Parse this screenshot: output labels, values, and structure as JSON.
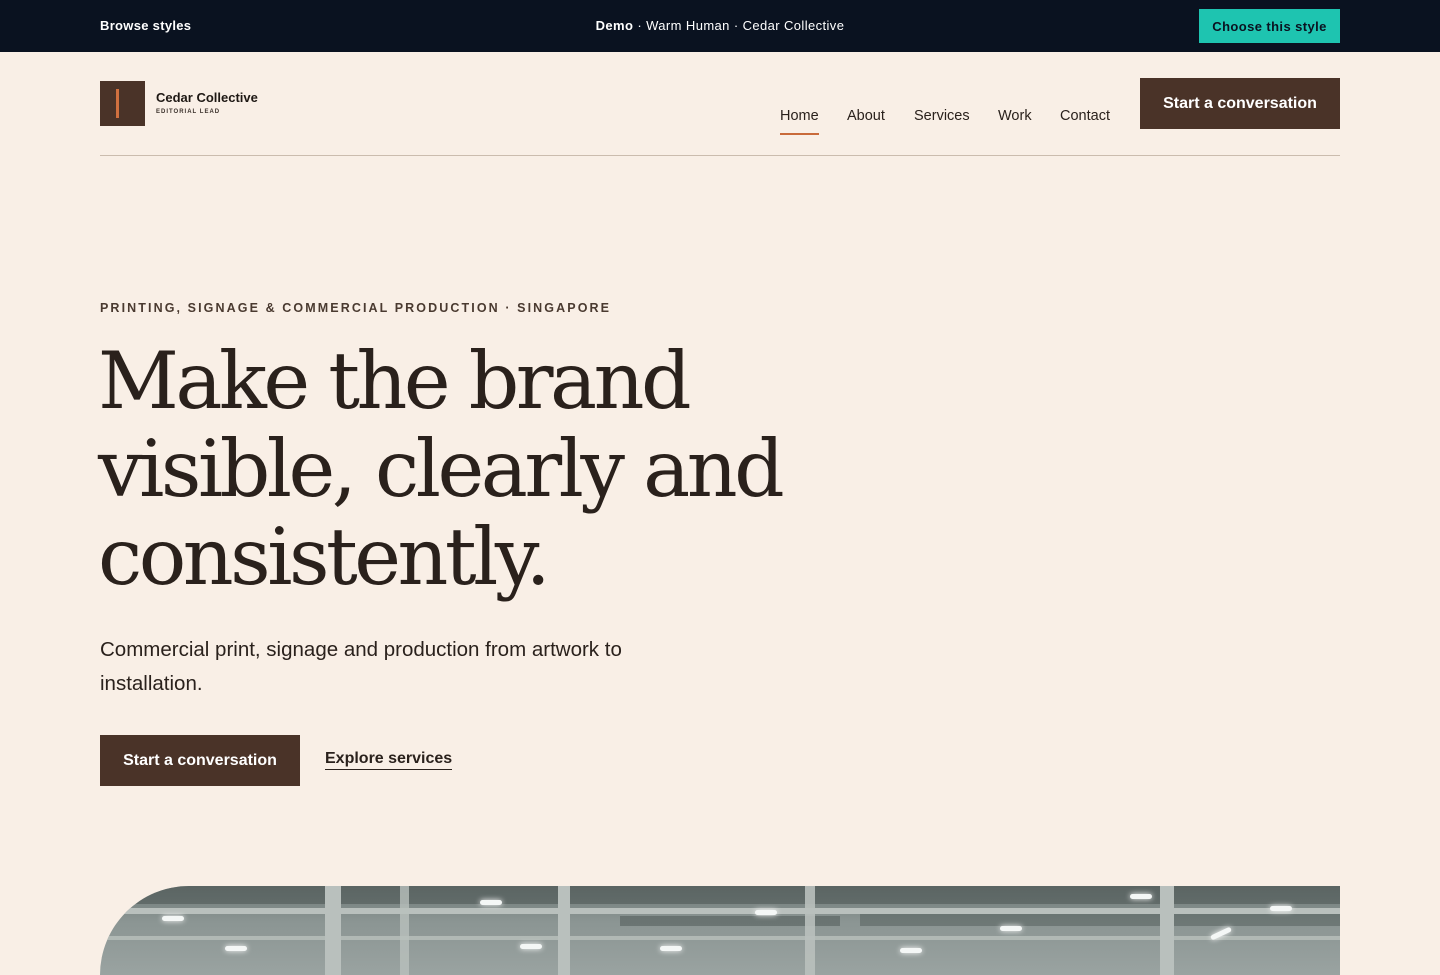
{
  "demo_bar": {
    "browse_label": "Browse styles",
    "demo_label": "Demo",
    "context": "· Warm Human · Cedar Collective",
    "choose_label": "Choose this style"
  },
  "header": {
    "brand_name": "Cedar Collective",
    "brand_tag": "EDITORIAL LEAD",
    "nav": [
      "Home",
      "About",
      "Services",
      "Work",
      "Contact"
    ],
    "active_nav": "Home",
    "cta_label": "Start a conversation"
  },
  "hero": {
    "eyebrow": "PRINTING, SIGNAGE & COMMERCIAL PRODUCTION · SINGAPORE",
    "headline": "Make the brand visible, clearly and consistently.",
    "lede": "Commercial print, signage and production from artwork to installation.",
    "primary_cta": "Start a conversation",
    "secondary_cta": "Explore services"
  },
  "colors": {
    "page_background": "#f9efe6",
    "demo_bar": "#0a1220",
    "accent_teal": "#1ec4b0",
    "brand_brown": "#4a3328",
    "active_underline": "#c96a3a"
  }
}
